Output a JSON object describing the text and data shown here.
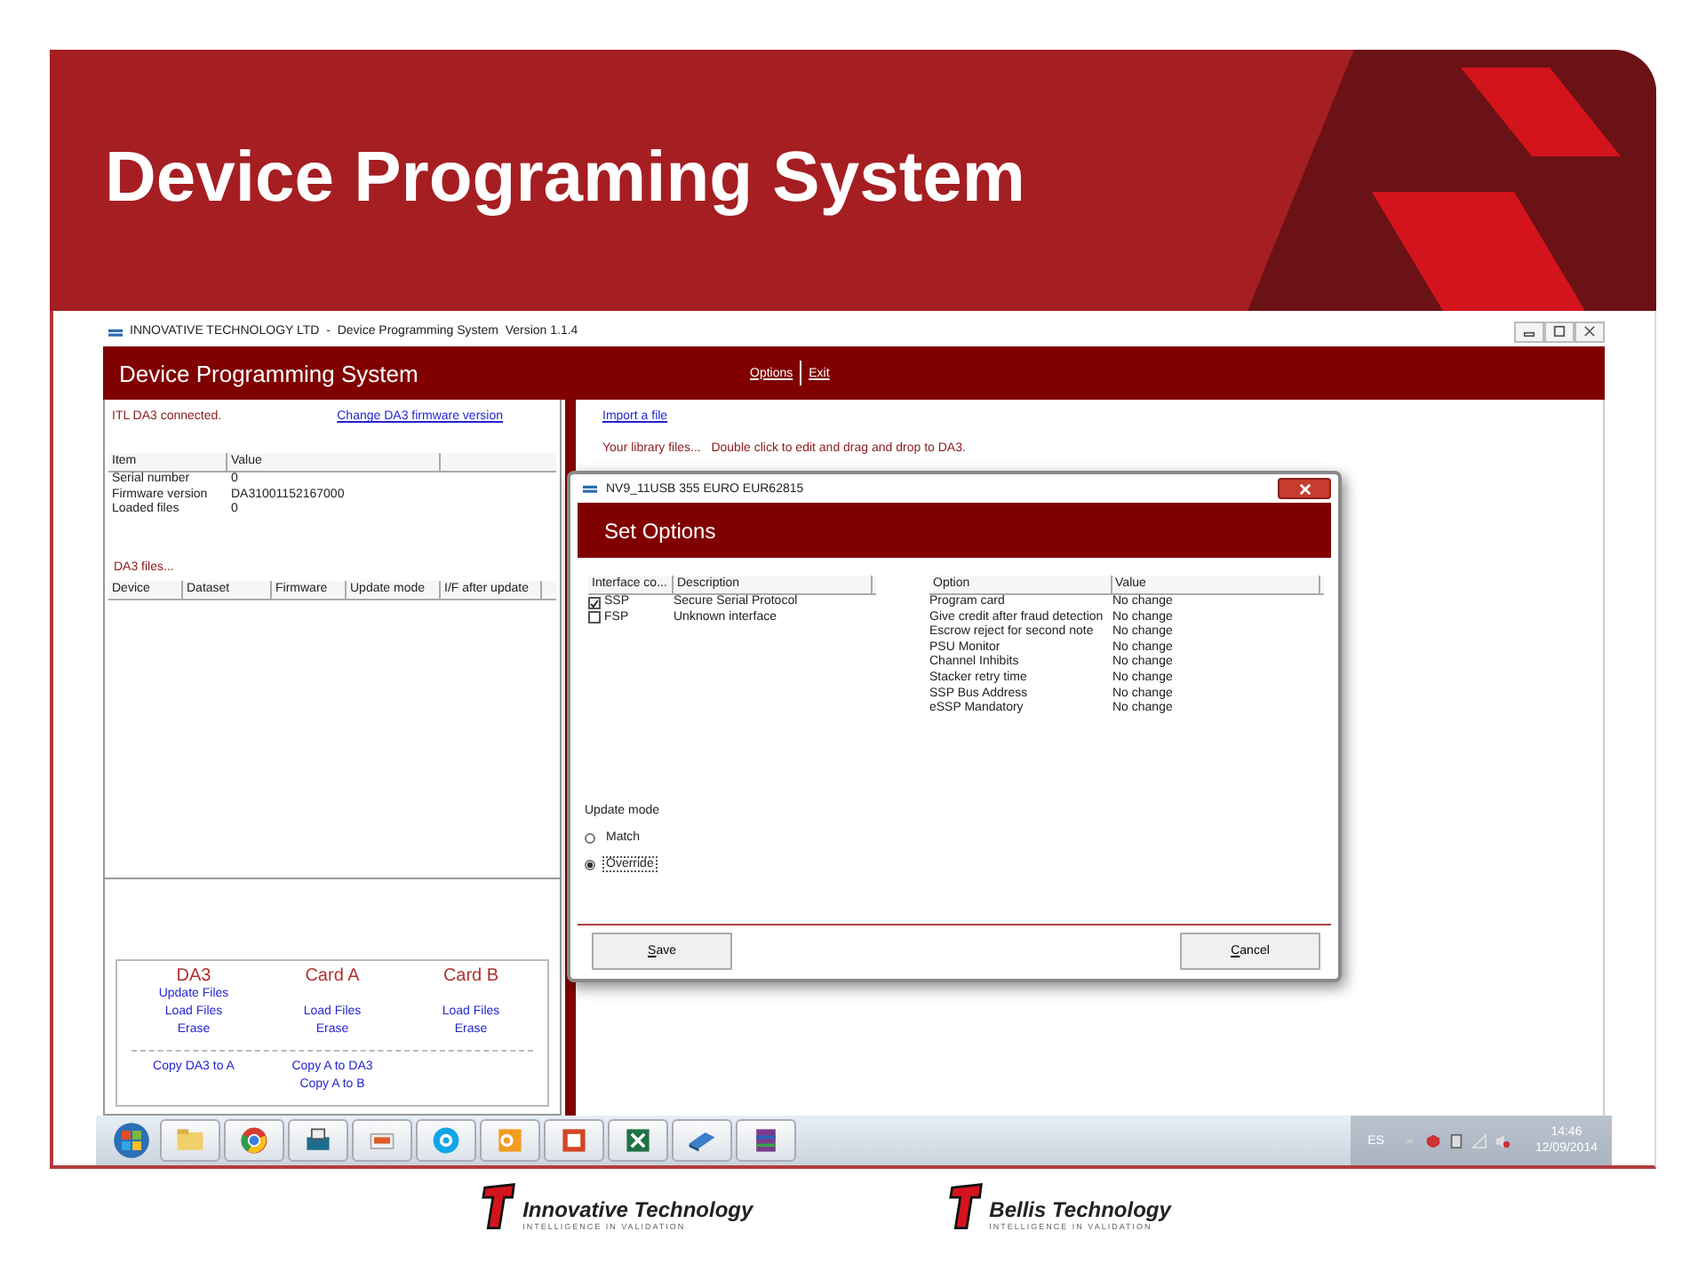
{
  "slide": {
    "title": "Device Programing System"
  },
  "window": {
    "title": "INNOVATIVE TECHNOLOGY LTD  -  Device Programming System  Version 1.1.4"
  },
  "app": {
    "title": "Device Programming System",
    "menu": [
      "Options",
      "Exit"
    ]
  },
  "left_panel": {
    "status": "ITL DA3 connected.",
    "change_link": "Change DA3 firmware version",
    "info_columns": [
      "Item",
      "Value"
    ],
    "info_rows": [
      {
        "item": "Serial number",
        "value": "0"
      },
      {
        "item": "Firmware version",
        "value": "DA31001152167000"
      },
      {
        "item": "Loaded files",
        "value": "0"
      }
    ],
    "files_label": "DA3 files...",
    "files_columns": [
      "Device",
      "Dataset",
      "Firmware",
      "Update mode",
      "I/F after update"
    ],
    "action_groups": [
      {
        "title": "DA3",
        "links": [
          "Update Files",
          "Load Files",
          "Erase"
        ]
      },
      {
        "title": "Card A",
        "links": [
          "Load Files",
          "Erase"
        ]
      },
      {
        "title": "Card B",
        "links": [
          "Load Files",
          "Erase"
        ]
      }
    ],
    "copy_links": [
      [
        "Copy DA3 to A"
      ],
      [
        "Copy A to DA3",
        "Copy A to B"
      ]
    ]
  },
  "right_panel": {
    "import_link": "Import a file",
    "library_hint": "Your library files...   Double click to edit and drag and drop to DA3."
  },
  "dialog": {
    "title": "NV9_11USB 355 EURO EUR62815",
    "heading": "Set Options",
    "interface_columns": [
      "Interface co...",
      "Description"
    ],
    "interfaces": [
      {
        "code": "SSP",
        "description": "Secure Serial Protocol",
        "checked": true
      },
      {
        "code": "FSP",
        "description": "Unknown interface",
        "checked": false
      }
    ],
    "option_columns": [
      "Option",
      "Value"
    ],
    "options": [
      {
        "option": "Program card",
        "value": "No change"
      },
      {
        "option": "Give credit after fraud detection",
        "value": "No change"
      },
      {
        "option": "Escrow reject for second note",
        "value": "No change"
      },
      {
        "option": "PSU Monitor",
        "value": "No change"
      },
      {
        "option": "Channel Inhibits",
        "value": "No change"
      },
      {
        "option": "Stacker retry time",
        "value": "No change"
      },
      {
        "option": "SSP Bus Address",
        "value": "No change"
      },
      {
        "option": "eSSP Mandatory",
        "value": "No change"
      }
    ],
    "update_mode": {
      "label": "Update mode",
      "choices": [
        {
          "label": "Match",
          "selected": false
        },
        {
          "label": "Override",
          "selected": true
        }
      ]
    },
    "buttons": [
      "Save",
      "Cancel"
    ]
  },
  "taskbar": {
    "language": "ES",
    "time": "14:46",
    "date": "12/09/2014"
  },
  "logos": [
    {
      "name": "Innovative Technology",
      "tagline": "INTELLIGENCE IN VALIDATION"
    },
    {
      "name": "Bellis Technology",
      "tagline": "INTELLIGENCE IN VALIDATION"
    }
  ]
}
